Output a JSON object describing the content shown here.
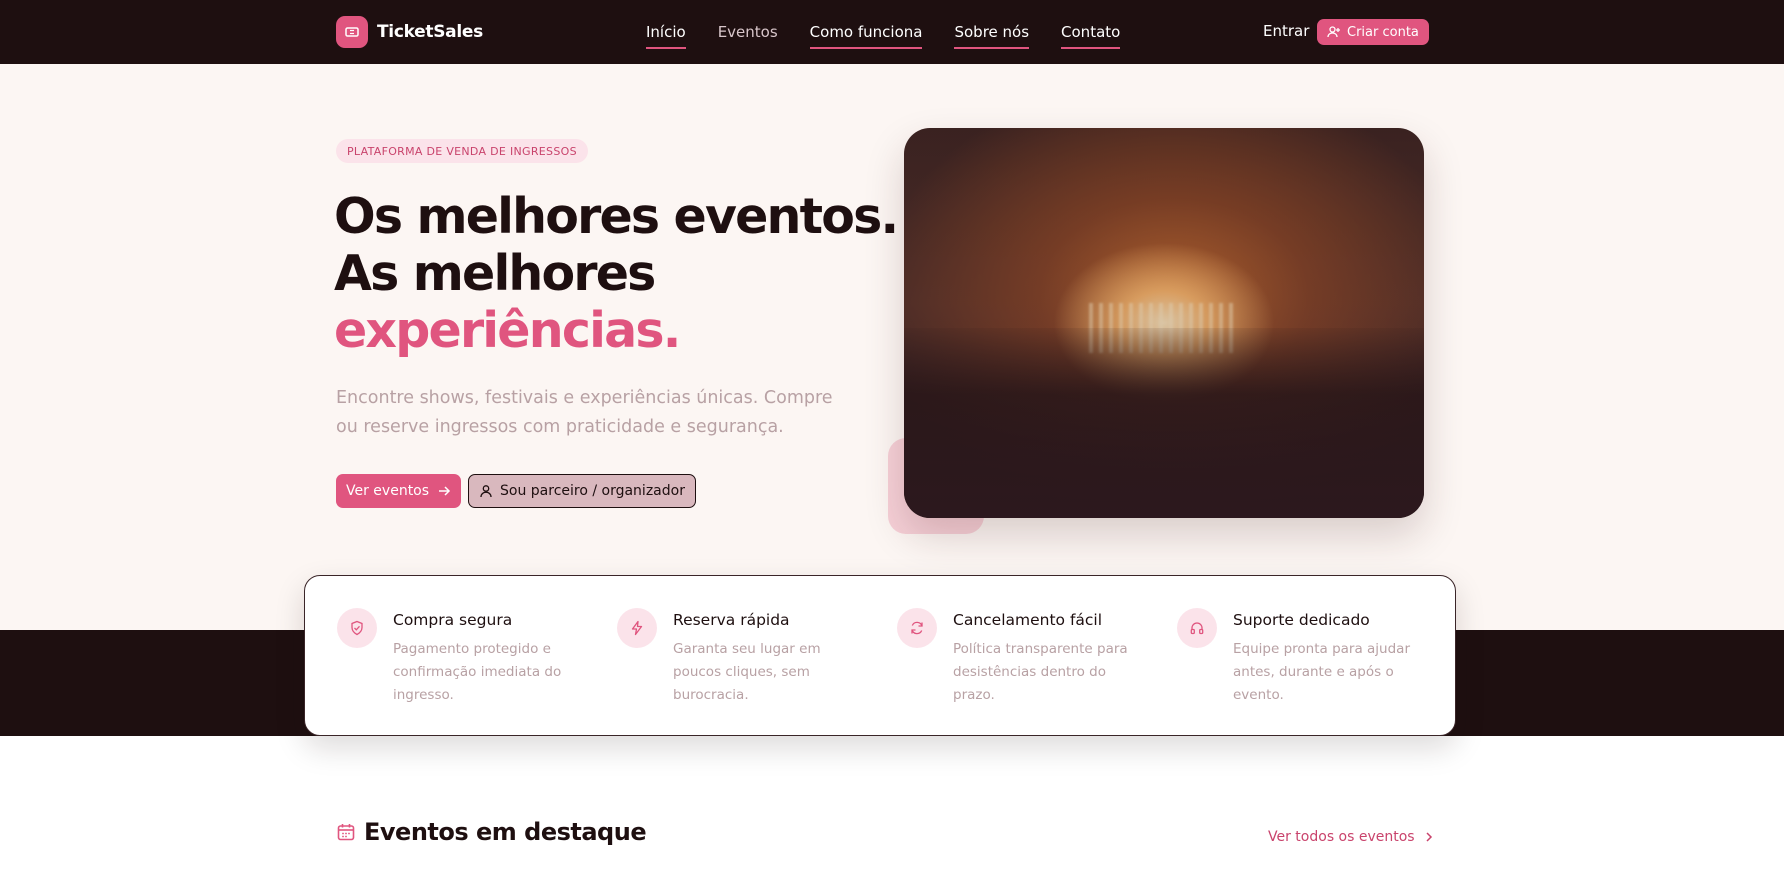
{
  "brand": {
    "name": "TicketSales"
  },
  "nav": {
    "items": [
      {
        "label": "Início"
      },
      {
        "label": "Eventos"
      },
      {
        "label": "Como funciona"
      },
      {
        "label": "Sobre nós"
      },
      {
        "label": "Contato"
      }
    ],
    "login_label": "Entrar",
    "signup_label": "Criar conta"
  },
  "hero": {
    "badge": "PLATAFORMA DE VENDA DE INGRESSOS",
    "headline_line1": "Os melhores eventos.",
    "headline_line2": "As melhores",
    "headline_accent": "experiências.",
    "subtitle": "Encontre shows, festivais e experiências únicas. Compre ou reserve ingressos com praticidade e segurança.",
    "primary_cta": "Ver eventos",
    "secondary_cta": "Sou parceiro / organizador"
  },
  "features": [
    {
      "icon": "shield-check-icon",
      "title": "Compra segura",
      "desc": "Pagamento protegido e confirmação imediata do ingresso."
    },
    {
      "icon": "lightning-icon",
      "title": "Reserva rápida",
      "desc": "Garanta seu lugar em poucos cliques, sem burocracia."
    },
    {
      "icon": "refresh-icon",
      "title": "Cancelamento fácil",
      "desc": "Política transparente para desistências dentro do prazo."
    },
    {
      "icon": "headphones-icon",
      "title": "Suporte dedicado",
      "desc": "Equipe pronta para ajudar antes, durante e após o evento."
    }
  ],
  "featured": {
    "title": "Eventos em destaque",
    "see_all": "Ver todos os eventos"
  },
  "colors": {
    "accent": "#e0557f",
    "dark": "#1e0f10",
    "hero_bg": "#fcf6f3",
    "muted_text": "#b8a1a4"
  }
}
